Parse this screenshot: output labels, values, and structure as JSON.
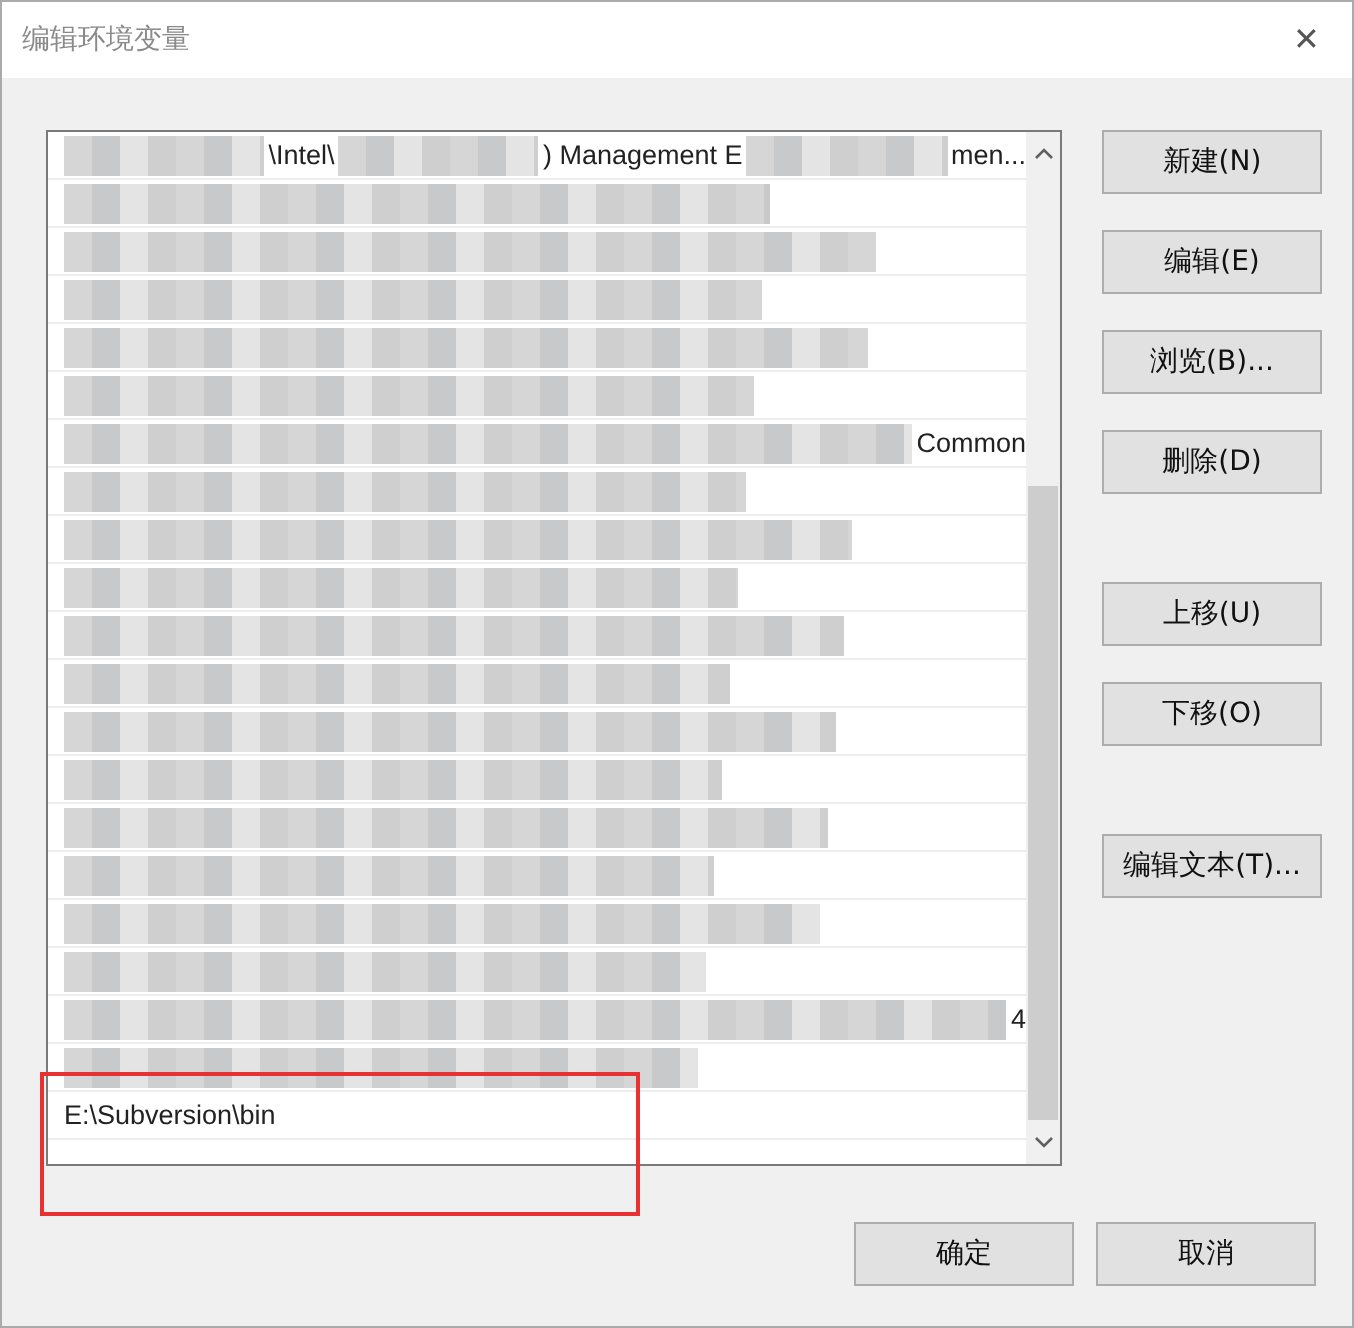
{
  "window": {
    "title": "编辑环境变量",
    "close": "✕"
  },
  "list": {
    "rows": [
      {
        "segments": [
          {
            "kind": "mosaic"
          },
          {
            "kind": "text",
            "text": "\\Intel\\"
          },
          {
            "kind": "mosaic"
          },
          {
            "kind": "text",
            "text": ") Management E"
          },
          {
            "kind": "mosaic"
          },
          {
            "kind": "text",
            "text": "men..."
          }
        ]
      },
      {
        "segments": [
          {
            "kind": "mosaic"
          }
        ]
      },
      {
        "segments": [
          {
            "kind": "mosaic"
          }
        ]
      },
      {
        "segments": [
          {
            "kind": "mosaic"
          }
        ]
      },
      {
        "segments": [
          {
            "kind": "mosaic"
          }
        ]
      },
      {
        "segments": [
          {
            "kind": "mosaic"
          }
        ]
      },
      {
        "segments": [
          {
            "kind": "mosaic"
          },
          {
            "kind": "text",
            "text": "Common"
          }
        ]
      },
      {
        "segments": [
          {
            "kind": "mosaic"
          }
        ]
      },
      {
        "segments": [
          {
            "kind": "mosaic"
          }
        ]
      },
      {
        "segments": [
          {
            "kind": "mosaic"
          }
        ]
      },
      {
        "segments": [
          {
            "kind": "mosaic"
          }
        ]
      },
      {
        "segments": [
          {
            "kind": "mosaic"
          }
        ]
      },
      {
        "segments": [
          {
            "kind": "mosaic"
          }
        ]
      },
      {
        "segments": [
          {
            "kind": "mosaic"
          }
        ]
      },
      {
        "segments": [
          {
            "kind": "mosaic"
          }
        ]
      },
      {
        "segments": [
          {
            "kind": "mosaic"
          }
        ]
      },
      {
        "segments": [
          {
            "kind": "mosaic"
          }
        ]
      },
      {
        "segments": [
          {
            "kind": "mosaic"
          }
        ]
      },
      {
        "segments": [
          {
            "kind": "mosaic"
          },
          {
            "kind": "text",
            "text": "4"
          }
        ]
      },
      {
        "segments": [
          {
            "kind": "mosaic"
          }
        ]
      },
      {
        "segments": [
          {
            "kind": "text",
            "text": "E:\\Subversion\\bin"
          }
        ]
      }
    ]
  },
  "side_button_groups": [
    [
      "新建(N)",
      "编辑(E)",
      "浏览(B)...",
      "删除(D)"
    ],
    [
      "上移(U)",
      "下移(O)"
    ],
    [
      "编辑文本(T)..."
    ]
  ],
  "footer_buttons": [
    "确定",
    "取消"
  ]
}
